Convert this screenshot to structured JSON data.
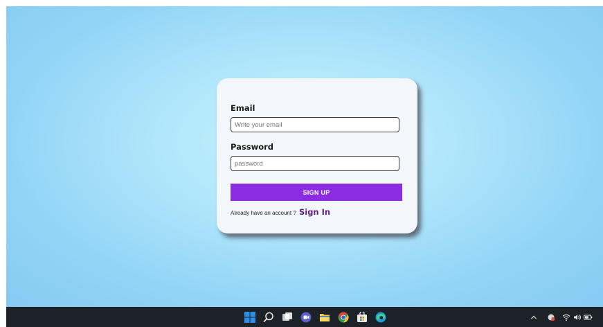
{
  "form": {
    "email_label": "Email",
    "email_placeholder": "Write your email",
    "email_value": "",
    "password_label": "Password",
    "password_placeholder": "password",
    "password_value": "",
    "submit_label": "SIGN UP",
    "account_prompt": "Already have an account ?",
    "signin_link": "Sign In"
  },
  "colors": {
    "accent": "#8b2be2",
    "link": "#5a1f8c",
    "card": "#f3f6fa",
    "taskbar": "#1d2228"
  },
  "taskbar": {
    "icons": [
      "start-icon",
      "search-icon",
      "task-view-icon",
      "chat-icon",
      "file-explorer-icon",
      "chrome-icon",
      "store-icon",
      "edge-icon"
    ],
    "tray": [
      "chevron-up-icon",
      "app-tray-icon",
      "wifi-icon",
      "volume-icon",
      "battery-icon"
    ]
  }
}
